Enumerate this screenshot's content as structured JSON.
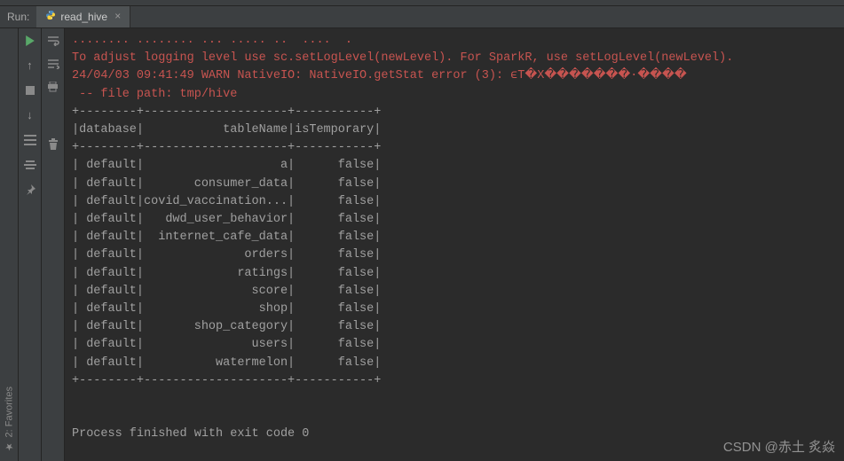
{
  "panel": {
    "label": "Run:"
  },
  "tab": {
    "icon_name": "python-file-icon",
    "name": "read_hive",
    "close": "×"
  },
  "gutter1": {
    "run": "▶",
    "up": "↑",
    "stop": "■",
    "down": "↓",
    "layout": "≡",
    "step": "≣",
    "pin": "📌"
  },
  "gutter2": {
    "wrap": "⤶",
    "print": "🖶",
    "trash": "🗑"
  },
  "log": {
    "l0": "........ ........ ... ..... ..  ....  .",
    "l1": "To adjust logging level use sc.setLogLevel(newLevel). For SparkR, use setLogLevel(newLevel).",
    "l2": "24/04/03 09:41:49 WARN NativeIO: NativeIO.getStat error (3): ϵT�X�������·����",
    "l3": " -- file path: tmp/hive"
  },
  "table": {
    "border": "+--------+--------------------+-----------+",
    "header": "|database|           tableName|isTemporary|",
    "columns": [
      "database",
      "tableName",
      "isTemporary"
    ],
    "rows": [
      {
        "database": "default",
        "tableName": "a",
        "isTemporary": "false"
      },
      {
        "database": "default",
        "tableName": "consumer_data",
        "isTemporary": "false"
      },
      {
        "database": "default",
        "tableName": "covid_vaccination...",
        "isTemporary": "false"
      },
      {
        "database": "default",
        "tableName": "dwd_user_behavior",
        "isTemporary": "false"
      },
      {
        "database": "default",
        "tableName": "internet_cafe_data",
        "isTemporary": "false"
      },
      {
        "database": "default",
        "tableName": "orders",
        "isTemporary": "false"
      },
      {
        "database": "default",
        "tableName": "ratings",
        "isTemporary": "false"
      },
      {
        "database": "default",
        "tableName": "score",
        "isTemporary": "false"
      },
      {
        "database": "default",
        "tableName": "shop",
        "isTemporary": "false"
      },
      {
        "database": "default",
        "tableName": "shop_category",
        "isTemporary": "false"
      },
      {
        "database": "default",
        "tableName": "users",
        "isTemporary": "false"
      },
      {
        "database": "default",
        "tableName": "watermelon",
        "isTemporary": "false"
      }
    ]
  },
  "footer": {
    "exit": "Process finished with exit code 0"
  },
  "sidebar": {
    "fav": "2: Favorites",
    "star": "★"
  },
  "watermark": "CSDN @赤土 炙焱"
}
